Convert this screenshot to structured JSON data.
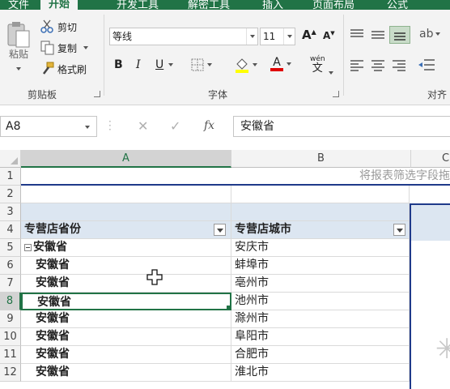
{
  "tabs": [
    {
      "label": "文件",
      "active": false
    },
    {
      "label": "开始",
      "active": true
    },
    {
      "label": "开发工具",
      "active": false
    },
    {
      "label": "解密工具",
      "active": false
    },
    {
      "label": "插入",
      "active": false
    },
    {
      "label": "页面布局",
      "active": false
    },
    {
      "label": "公式",
      "active": false
    }
  ],
  "clipboard": {
    "paste_label": "粘贴",
    "cut_label": "剪切",
    "copy_label": "复制",
    "format_painter_label": "格式刷",
    "group_label": "剪贴板"
  },
  "font": {
    "name_value": "等线",
    "size_value": "11",
    "grow_label": "A",
    "shrink_label": "A",
    "bold_label": "B",
    "italic_label": "I",
    "underline_label": "U",
    "font_color_label": "A",
    "phonetic_top": "wén",
    "phonetic_bottom": "文",
    "group_label": "字体"
  },
  "alignment": {
    "group_label": "对齐"
  },
  "formula_bar": {
    "name_box": "A8",
    "fx_label": "fx",
    "content": "安徽省"
  },
  "columns": [
    "A",
    "B",
    "C"
  ],
  "selected_column": "A",
  "rows": [
    "1",
    "2",
    "3",
    "4",
    "5",
    "6",
    "7",
    "8",
    "9",
    "10",
    "11",
    "12"
  ],
  "selected_row": "8",
  "pivot": {
    "hint_text": "将报表筛选字段拖",
    "header_province": "专营店省份",
    "header_city": "专营店城市",
    "records": [
      {
        "province": "安徽省",
        "city": "安庆市"
      },
      {
        "province": "安徽省",
        "city": "蚌埠市"
      },
      {
        "province": "安徽省",
        "city": "亳州市"
      },
      {
        "province": "安徽省",
        "city": "池州市"
      },
      {
        "province": "安徽省",
        "city": "滁州市"
      },
      {
        "province": "安徽省",
        "city": "阜阳市"
      },
      {
        "province": "安徽省",
        "city": "合肥市"
      },
      {
        "province": "安徽省",
        "city": "淮北市"
      }
    ]
  },
  "colors": {
    "accent": "#217346",
    "pivot_header": "#dce6f1",
    "pivot_border": "#1f3a8a"
  }
}
